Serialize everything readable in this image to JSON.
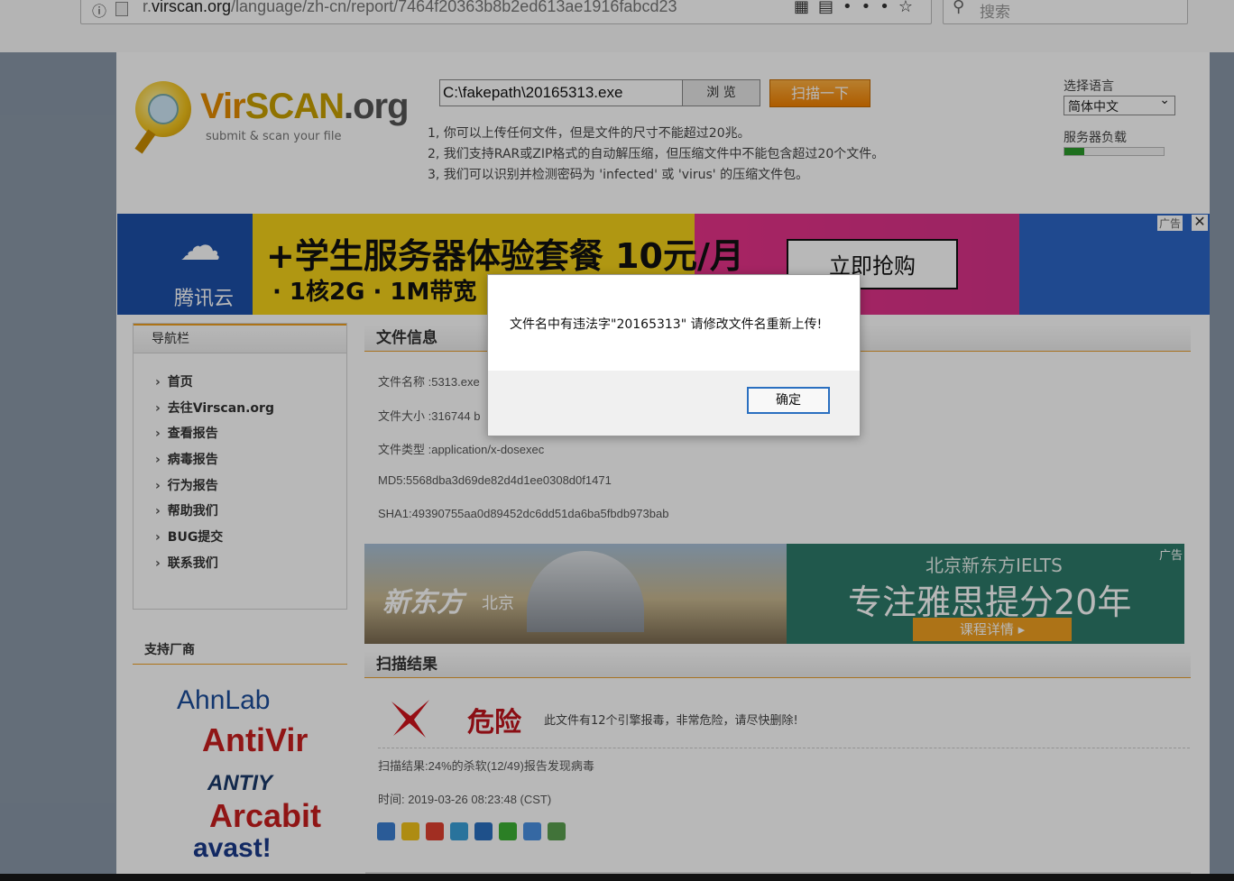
{
  "browser": {
    "url_prefix": "r.",
    "url_domain": "virscan.org",
    "url_path": "/language/zh-cn/report/7464f20363b8b2ed613ae1916fabcd23",
    "search_placeholder": "搜索",
    "toolbar_icons": [
      "info-icon",
      "page-icon",
      "qr-code-icon",
      "reader-icon",
      "more-icon",
      "bookmark-star-icon"
    ]
  },
  "header": {
    "logo_vir": "Vir",
    "logo_scan": "SCAN",
    "logo_org": ".org",
    "logo_tagline": "submit & scan your file",
    "file_path": "C:\\fakepath\\20165313.exe",
    "browse_label": "浏 览",
    "scan_label": "扫描一下",
    "rules": [
      "1, 你可以上传任何文件，但是文件的尺寸不能超过20兆。",
      "2, 我们支持RAR或ZIP格式的自动解压缩，但压缩文件中不能包含超过20个文件。",
      "3, 我们可以识别并检测密码为 'infected' 或 'virus' 的压缩文件包。"
    ],
    "language_label": "选择语言",
    "language_value": "简体中文",
    "server_load_label": "服务器负载",
    "server_load_fraction": 0.2
  },
  "ad_banner": {
    "brand": "腾讯云",
    "headline": "+学生服务器体验套餐 10元/月",
    "subline": "· 1核2G · 1M带宽",
    "cta": "立即抢购",
    "ad_tag": "广告"
  },
  "sidebar": {
    "title": "导航栏",
    "items": [
      "首页",
      "去往Virscan.org",
      "查看报告",
      "病毒报告",
      "行为报告",
      "帮助我们",
      "BUG提交",
      "联系我们"
    ]
  },
  "vendors": {
    "title": "支持厂商",
    "logos": [
      "AhnLab",
      "AntiVir",
      "ANTIY",
      "Arcabit",
      "avast!"
    ]
  },
  "file_info": {
    "title": "文件信息",
    "name": "文件名称 :5313.exe",
    "size": "文件大小 :316744 b",
    "type": "文件类型 :application/x-dosexec",
    "md5": "MD5:5568dba3d69de82d4d1ee0308d0f1471",
    "sha1": "SHA1:49390755aa0d89452dc6dd51da6ba5fbdb973bab"
  },
  "ad2": {
    "left_brand": "新东方",
    "left_city": "北京",
    "top": "北京新东方IELTS",
    "main": "专注雅思提分20年",
    "cta": "课程详情 ▸",
    "tag": "广告"
  },
  "scan_result": {
    "title": "扫描结果",
    "level": "危险",
    "message": "此文件有12个引擎报毒，非常危险，请尽快删除!",
    "summary": "扫描结果:24%的杀软(12/49)报告发现病毒",
    "time": "时间: 2019-03-26 08:23:48 (CST)",
    "share_icons": [
      "share-plus-icon",
      "qzone-icon",
      "weibo-icon",
      "tencent-weibo-icon",
      "renren-icon",
      "wechat-icon",
      "douban-icon",
      "tieba-icon"
    ]
  },
  "dialog": {
    "message": "文件名中有违法字\"20165313\" 请修改文件名重新上传!",
    "ok_label": "确定"
  }
}
